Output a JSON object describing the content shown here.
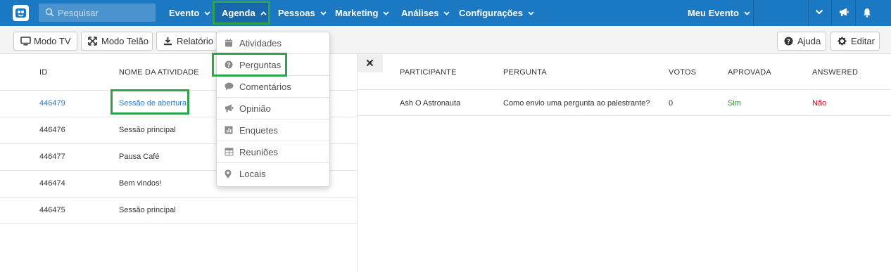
{
  "search": {
    "placeholder": "Pesquisar"
  },
  "nav": {
    "evento": "Evento",
    "agenda": "Agenda",
    "pessoas": "Pessoas",
    "marketing": "Marketing",
    "analises": "Análises",
    "configuracoes": "Configurações",
    "meu_evento": "Meu Evento"
  },
  "toolbar": {
    "modo_tv": "Modo TV",
    "modo_telao": "Modo Telão",
    "relatorio": "Relatório",
    "ajuda": "Ajuda",
    "editar": "Editar"
  },
  "dropdown": {
    "items": [
      {
        "label": "Atividades",
        "icon": "calendar-icon"
      },
      {
        "label": "Perguntas",
        "icon": "question-circle-icon"
      },
      {
        "label": "Comentários",
        "icon": "comment-icon"
      },
      {
        "label": "Opinião",
        "icon": "megaphone-icon"
      },
      {
        "label": "Enquetes",
        "icon": "poll-chart-icon"
      },
      {
        "label": "Reuniões",
        "icon": "table-icon"
      },
      {
        "label": "Locais",
        "icon": "map-marker-icon"
      }
    ]
  },
  "activities": {
    "headers": {
      "id": "ID",
      "name": "NOME DA ATIVIDADE"
    },
    "rows": [
      {
        "id": "446479",
        "name": "Sessão de abertura"
      },
      {
        "id": "446476",
        "name": "Sessão principal"
      },
      {
        "id": "446477",
        "name": "Pausa Café"
      },
      {
        "id": "446474",
        "name": "Bem vindos!"
      },
      {
        "id": "446475",
        "name": "Sessão principal"
      }
    ]
  },
  "questions": {
    "headers": {
      "participant": "PARTICIPANTE",
      "question": "PERGUNTA",
      "votes": "VOTOS",
      "approved": "APROVADA",
      "answered": "ANSWERED"
    },
    "rows": [
      {
        "participant": "Ash O Astronauta",
        "question": "Como envio uma pergunta ao palestrante?",
        "votes": "0",
        "approved": "Sim",
        "answered": "Não"
      }
    ]
  },
  "colors": {
    "nav_bg": "#1b78c2",
    "highlight": "#2ea34a",
    "link": "#2a7ac7",
    "yes": "#2f8a2f",
    "no": "#d0021b"
  }
}
